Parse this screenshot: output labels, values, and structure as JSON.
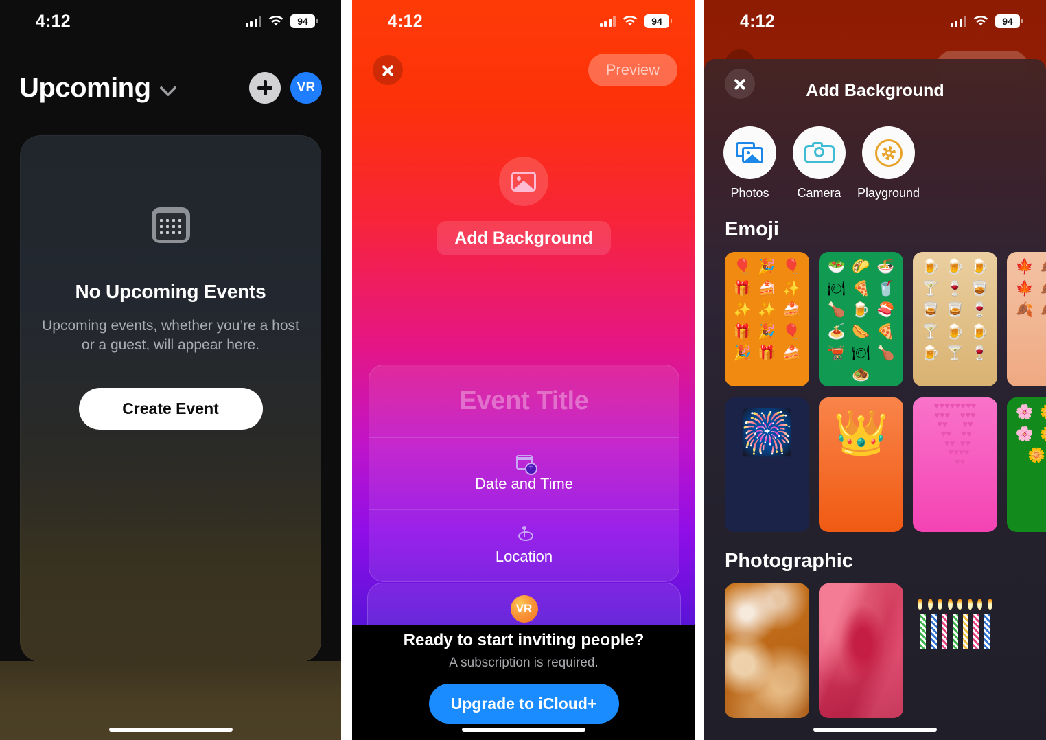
{
  "status_bar": {
    "time": "4:12",
    "battery": "94",
    "signal_icon": "cellular-signal-icon",
    "wifi_icon": "wifi-icon"
  },
  "panel_upcoming": {
    "title": "Upcoming",
    "chevron_icon": "chevron-down-icon",
    "add_button_icon": "plus-icon",
    "avatar_initials": "VR",
    "empty_icon": "calendar-icon",
    "empty_title": "No Upcoming Events",
    "empty_subtitle": "Upcoming events, whether you’re a host or a guest, will appear here.",
    "create_button": "Create Event"
  },
  "panel_create_event": {
    "close_icon": "close-icon",
    "preview_button": "Preview",
    "add_background_icon": "photo-icon",
    "add_background_label": "Add Background",
    "title_placeholder": "Event Title",
    "rows": [
      {
        "label": "Date and Time",
        "icon": "calendar-add-icon"
      },
      {
        "label": "Location",
        "icon": "location-pin-icon"
      }
    ],
    "host_avatar_initials": "VR",
    "invite_title": "Ready to start inviting people?",
    "invite_subtitle": "A subscription is required.",
    "upgrade_button": "Upgrade to iCloud+"
  },
  "panel_add_background": {
    "close_icon": "close-icon",
    "sheet_title": "Add Background",
    "sources": [
      {
        "label": "Photos",
        "icon": "photos-library-icon"
      },
      {
        "label": "Camera",
        "icon": "camera-icon"
      },
      {
        "label": "Playground",
        "icon": "image-playground-icon"
      }
    ],
    "sections": [
      {
        "heading": "Emoji",
        "rows": [
          [
            {
              "name": "gifts-and-cake-orange",
              "color": "#f08a10",
              "kind": "emoji-field",
              "emojis": "🎈 🎉 🎈 🎁 🍰 ✨ ✨ ✨ 🍰 🎁 🎉 🎈 🎉 🎁 🍰"
            },
            {
              "name": "food-green",
              "color": "#119a52",
              "kind": "emoji-field",
              "emojis": "🥗 🌮 🍜 🍽 🍕 🥤 🍗 🍺 🍣 🍝 🌭 🍕 🫕 🍽 🍗 🧆"
            },
            {
              "name": "drinks-tan",
              "color": "#e2c48d",
              "kind": "emoji-field",
              "emojis": "🍺 🍺 🍺 🍸 🍷 🥃 🥃 🥃 🍷 🍸 🍺 🍺 🍺 🍸 🍷"
            },
            {
              "name": "autumn-leaves-peach",
              "color": "#f0b491",
              "kind": "emoji-field",
              "emojis": "🍁 🍂 🍂 🍁 🍂 🍂 🍂 🍂 🍂"
            }
          ],
          [
            {
              "name": "fireworks-navy",
              "color": "#1b2448",
              "kind": "big-emoji",
              "emoji": "🎆"
            },
            {
              "name": "crown-orange",
              "color": "#f2601f",
              "kind": "big-emoji",
              "emoji": "👑"
            },
            {
              "name": "hearts-pink",
              "color": "#f45cc0",
              "kind": "heart-field",
              "emoji": "💗"
            },
            {
              "name": "flowers-green",
              "color": "#128a1c",
              "kind": "emoji-field",
              "emojis": "🌸 🌼 🌼 🌸 🌼 🌸 🌼 🌻"
            }
          ]
        ]
      },
      {
        "heading": "Photographic",
        "rows": [
          [
            {
              "name": "golden-glasses-photo",
              "kind": "photo",
              "style": "pt-glasses"
            },
            {
              "name": "pink-ribbon-gift-photo",
              "kind": "photo",
              "style": "pt-ribbon"
            },
            {
              "name": "birthday-candles-photo",
              "kind": "photo",
              "style": "pt-candles"
            },
            {
              "name": "confetti-photo",
              "kind": "photo",
              "style": "pt-confetti"
            }
          ]
        ]
      }
    ]
  },
  "colors": {
    "accent_blue": "#1a8cff",
    "avatar_blue": "#1f7dff",
    "panel2_gradient_top": "#fe3b07",
    "panel2_gradient_bottom": "#161079",
    "panel3_backdrop": "#8d1c03"
  }
}
